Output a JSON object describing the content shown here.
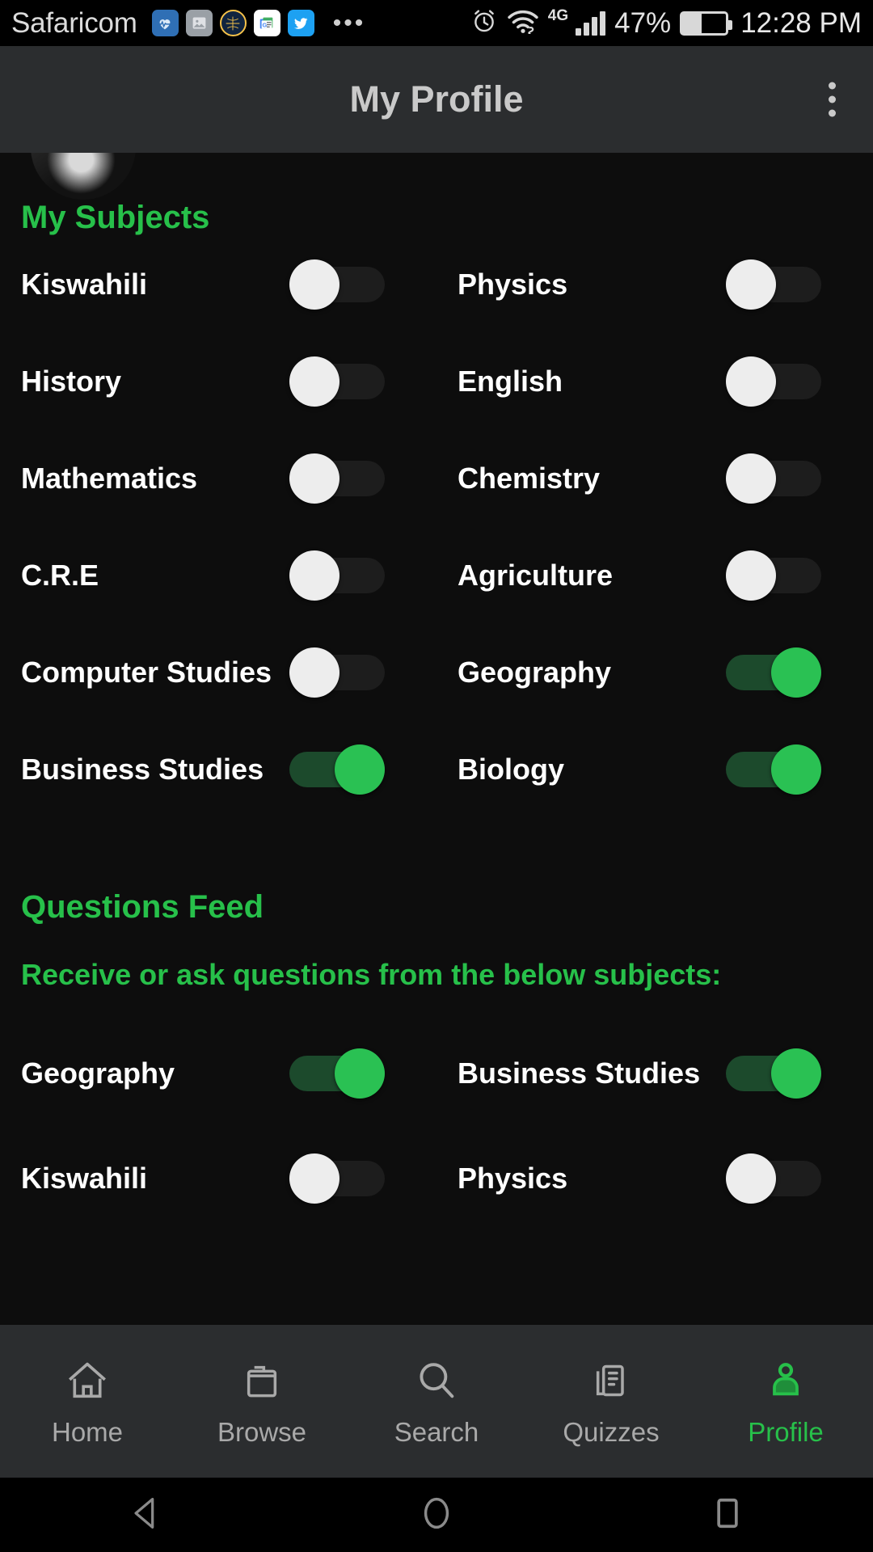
{
  "status_bar": {
    "carrier": "Safaricom",
    "battery_percent": "47%",
    "time": "12:28 PM",
    "network_type": "4G",
    "notification_icons": [
      "health-icon",
      "gallery-icon",
      "basketball-team-icon",
      "google-news-icon",
      "twitter-icon",
      "more-notifications-icon"
    ],
    "system_icons": [
      "alarm-icon",
      "wifi-icon",
      "signal-icon",
      "battery-icon"
    ]
  },
  "app_bar": {
    "title": "My Profile",
    "overflow_menu": "overflow-menu-icon"
  },
  "my_subjects": {
    "heading": "My Subjects",
    "items": [
      {
        "label": "Kiswahili",
        "on": false
      },
      {
        "label": "Physics",
        "on": false
      },
      {
        "label": "History",
        "on": false
      },
      {
        "label": "English",
        "on": false
      },
      {
        "label": "Mathematics",
        "on": false
      },
      {
        "label": "Chemistry",
        "on": false
      },
      {
        "label": "C.R.E",
        "on": false
      },
      {
        "label": "Agriculture",
        "on": false
      },
      {
        "label": "Computer Studies",
        "on": false
      },
      {
        "label": "Geography",
        "on": true
      },
      {
        "label": "Business Studies",
        "on": true
      },
      {
        "label": "Biology",
        "on": true
      }
    ]
  },
  "questions_feed": {
    "heading": "Questions Feed",
    "subheading": "Receive or ask questions from the below subjects:",
    "items": [
      {
        "label": "Geography",
        "on": true
      },
      {
        "label": "Business Studies",
        "on": true
      },
      {
        "label": "Kiswahili",
        "on": false
      },
      {
        "label": "Physics",
        "on": false
      }
    ]
  },
  "bottom_nav": {
    "items": [
      {
        "label": "Home",
        "icon": "home-icon",
        "active": false
      },
      {
        "label": "Browse",
        "icon": "folder-icon",
        "active": false
      },
      {
        "label": "Search",
        "icon": "search-icon",
        "active": false
      },
      {
        "label": "Quizzes",
        "icon": "document-list-icon",
        "active": false
      },
      {
        "label": "Profile",
        "icon": "person-icon",
        "active": true
      }
    ]
  },
  "system_nav": {
    "back": "back-triangle-icon",
    "home": "home-circle-icon",
    "recents": "recents-square-icon"
  },
  "colors": {
    "accent_green": "#27c04a",
    "switch_on_thumb": "#2ac153",
    "switch_on_track": "#1c4a2c",
    "background": "#0d0d0d",
    "bar_background": "#2b2d2f"
  }
}
